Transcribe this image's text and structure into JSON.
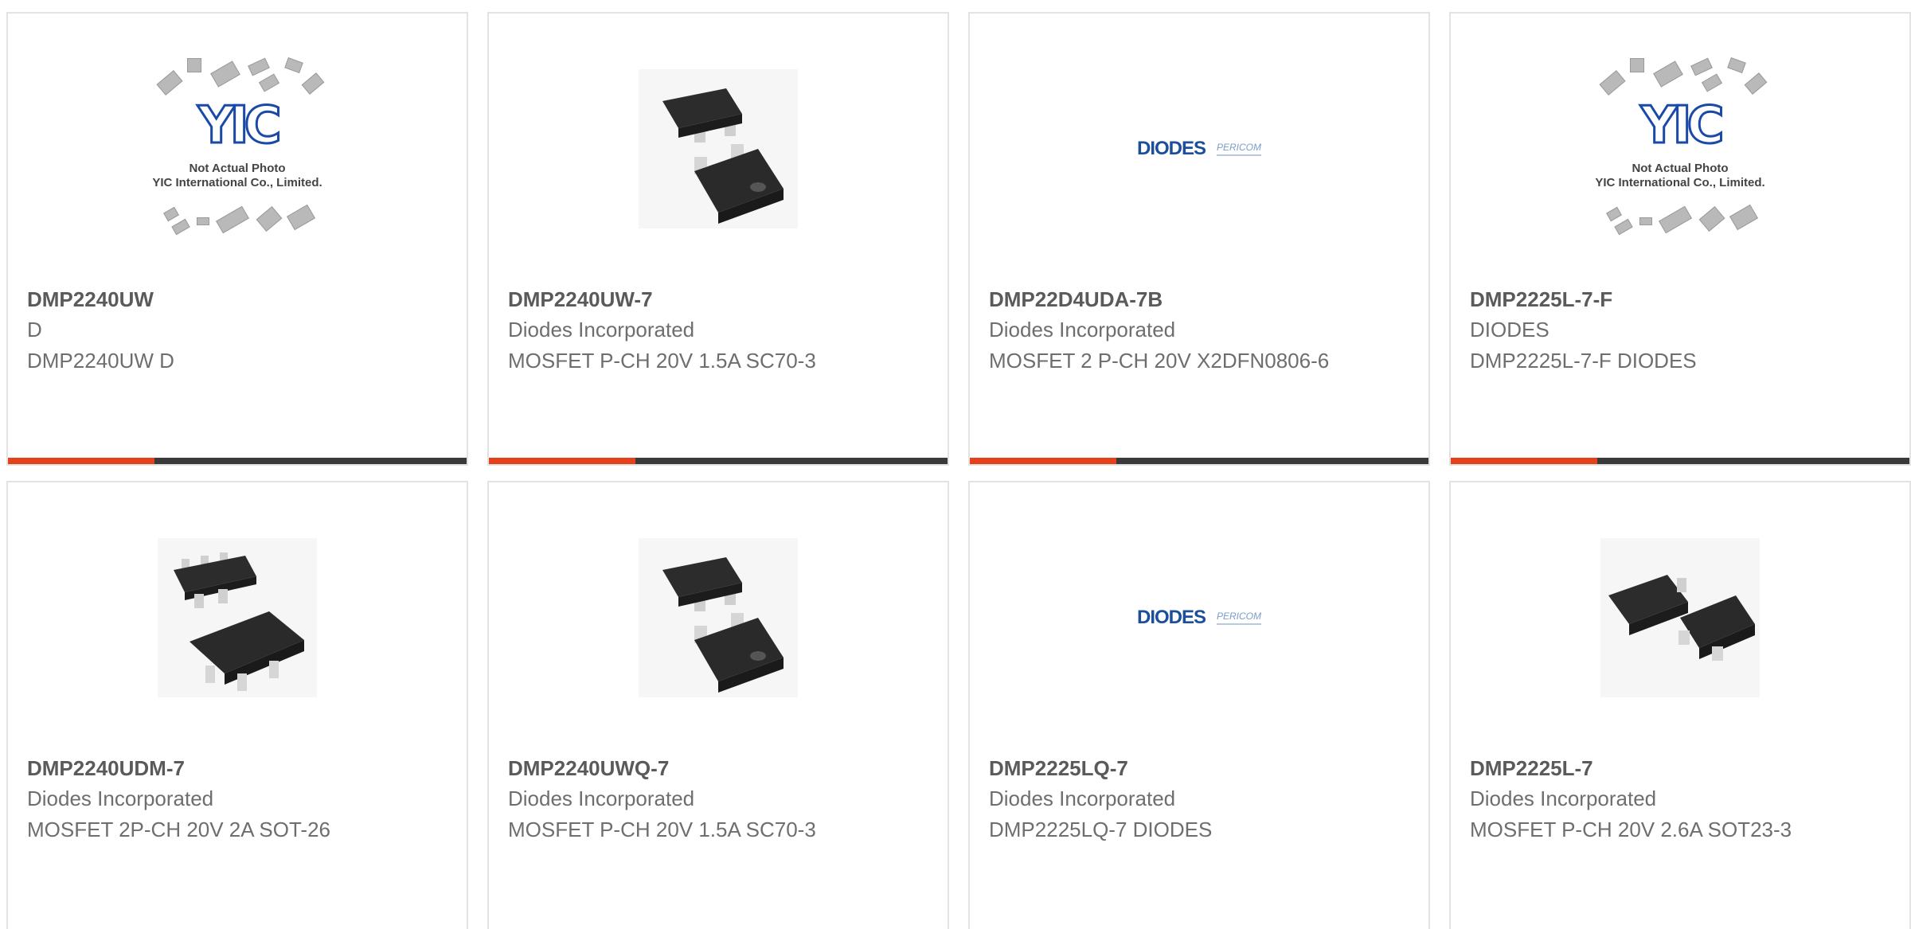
{
  "products": [
    {
      "part": "DMP2240UW",
      "mfr": "D",
      "desc": "DMP2240UW D",
      "image": "yic-placeholder"
    },
    {
      "part": "DMP2240UW-7",
      "mfr": "Diodes Incorporated",
      "desc": "MOSFET P-CH 20V 1.5A SC70-3",
      "image": "sc70-package"
    },
    {
      "part": "DMP22D4UDA-7B",
      "mfr": "Diodes Incorporated",
      "desc": "MOSFET 2 P-CH 20V X2DFN0806-6",
      "image": "diodes-logo"
    },
    {
      "part": "DMP2225L-7-F",
      "mfr": "DIODES",
      "desc": "DMP2225L-7-F DIODES",
      "image": "yic-placeholder"
    },
    {
      "part": "DMP2240UDM-7",
      "mfr": "Diodes Incorporated",
      "desc": "MOSFET 2P-CH 20V 2A SOT-26",
      "image": "sot26-package"
    },
    {
      "part": "DMP2240UWQ-7",
      "mfr": "Diodes Incorporated",
      "desc": "MOSFET P-CH 20V 1.5A SC70-3",
      "image": "sc70-package"
    },
    {
      "part": "DMP2225LQ-7",
      "mfr": "Diodes Incorporated",
      "desc": "DMP2225LQ-7 DIODES",
      "image": "diodes-logo"
    },
    {
      "part": "DMP2225L-7",
      "mfr": "Diodes Incorporated",
      "desc": "MOSFET P-CH 20V 2.6A SOT23-3",
      "image": "sot23-package"
    }
  ],
  "placeholder": {
    "line1": "Not Actual Photo",
    "line2": "YIC International Co., Limited.",
    "logo": "YIC"
  },
  "diodes_logo": {
    "main": "DIODES",
    "sub": "PERICOM"
  },
  "colors": {
    "accent": "#e4411a",
    "bar": "#3a3a3a",
    "text": "#6e6e6e",
    "diodes_blue": "#1c4f9b"
  }
}
